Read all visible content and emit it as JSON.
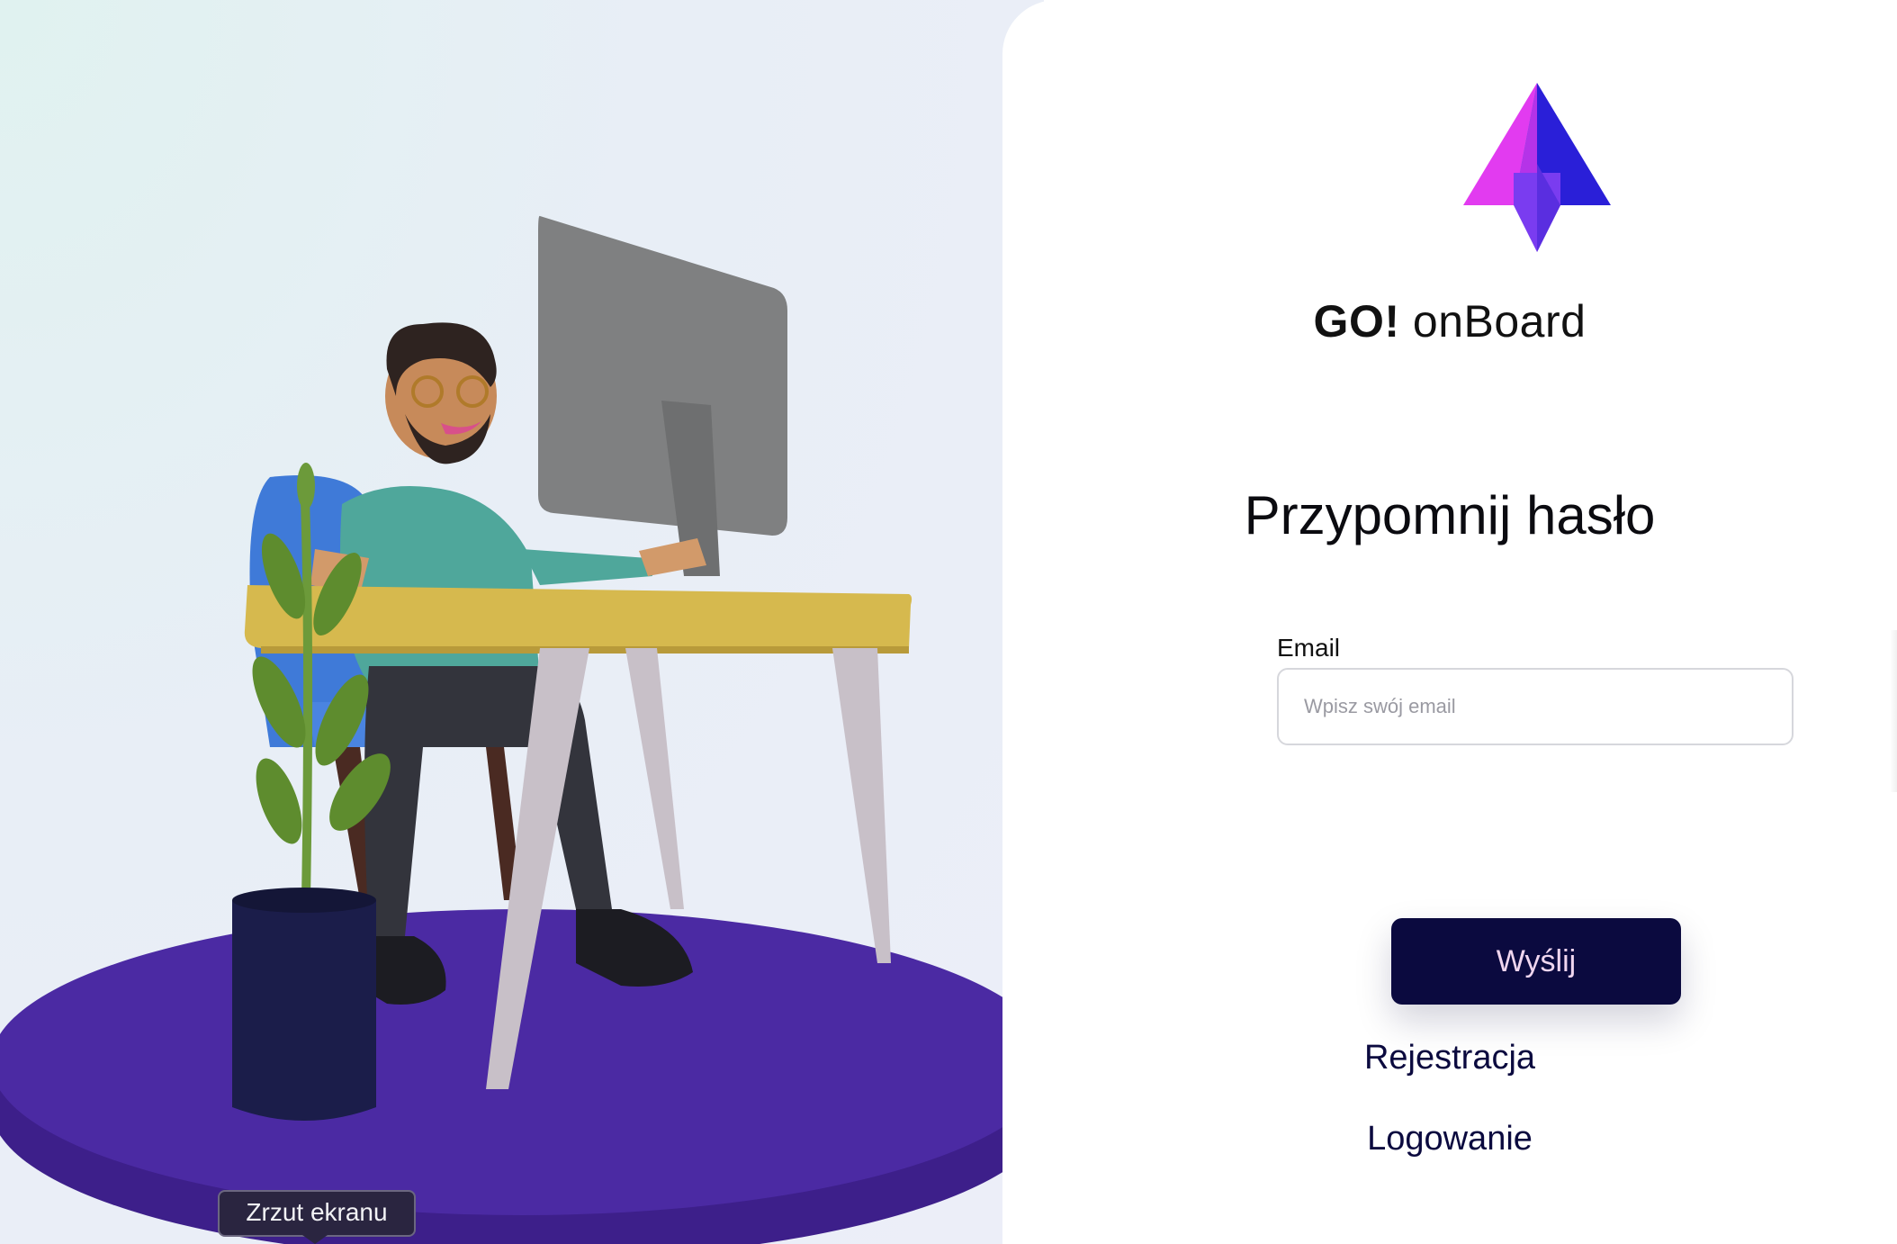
{
  "brand": {
    "name_bold": "GO!",
    "name_light": "onBoard",
    "logo_icon": "triangle-logo-icon",
    "logo_colors": {
      "pink": "#e23bf0",
      "blue": "#2a1fd8",
      "violet": "#7a3cf0"
    }
  },
  "form": {
    "title": "Przypomnij hasło",
    "email_label": "Email",
    "email_placeholder": "Wpisz swój email",
    "email_value": "",
    "submit_label": "Wyślij"
  },
  "links": {
    "register": "Rejestracja",
    "login": "Logowanie"
  },
  "tooltip": {
    "text": "Zrzut ekranu"
  },
  "illustration": {
    "description_icon": "person-at-desk-illustration"
  },
  "colors": {
    "primary": "#0b0a3f",
    "button_text": "#f0d6ef",
    "platform": "#4a2aa0"
  }
}
